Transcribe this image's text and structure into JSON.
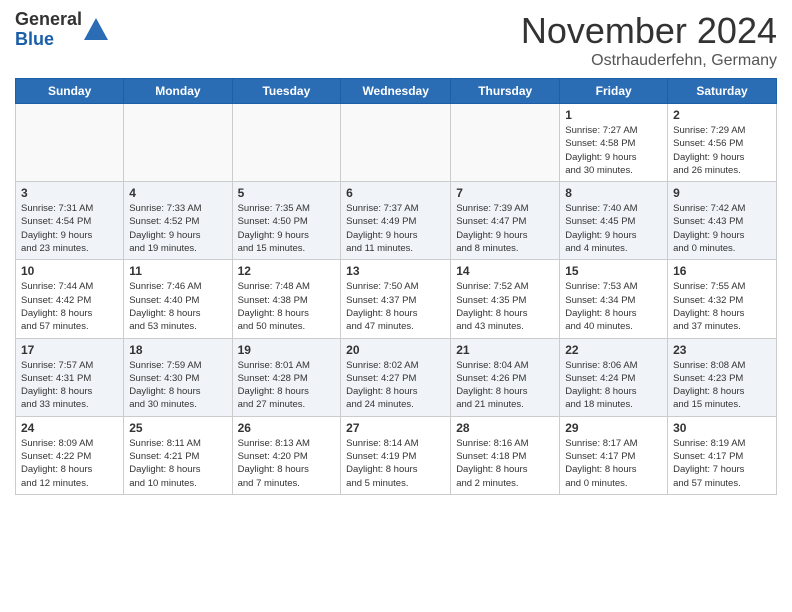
{
  "header": {
    "logo": {
      "general": "General",
      "blue": "Blue"
    },
    "title": "November 2024",
    "location": "Ostrhauderfehn, Germany"
  },
  "calendar": {
    "weekdays": [
      "Sunday",
      "Monday",
      "Tuesday",
      "Wednesday",
      "Thursday",
      "Friday",
      "Saturday"
    ],
    "rows": [
      [
        {
          "day": "",
          "info": ""
        },
        {
          "day": "",
          "info": ""
        },
        {
          "day": "",
          "info": ""
        },
        {
          "day": "",
          "info": ""
        },
        {
          "day": "",
          "info": ""
        },
        {
          "day": "1",
          "info": "Sunrise: 7:27 AM\nSunset: 4:58 PM\nDaylight: 9 hours\nand 30 minutes."
        },
        {
          "day": "2",
          "info": "Sunrise: 7:29 AM\nSunset: 4:56 PM\nDaylight: 9 hours\nand 26 minutes."
        }
      ],
      [
        {
          "day": "3",
          "info": "Sunrise: 7:31 AM\nSunset: 4:54 PM\nDaylight: 9 hours\nand 23 minutes."
        },
        {
          "day": "4",
          "info": "Sunrise: 7:33 AM\nSunset: 4:52 PM\nDaylight: 9 hours\nand 19 minutes."
        },
        {
          "day": "5",
          "info": "Sunrise: 7:35 AM\nSunset: 4:50 PM\nDaylight: 9 hours\nand 15 minutes."
        },
        {
          "day": "6",
          "info": "Sunrise: 7:37 AM\nSunset: 4:49 PM\nDaylight: 9 hours\nand 11 minutes."
        },
        {
          "day": "7",
          "info": "Sunrise: 7:39 AM\nSunset: 4:47 PM\nDaylight: 9 hours\nand 8 minutes."
        },
        {
          "day": "8",
          "info": "Sunrise: 7:40 AM\nSunset: 4:45 PM\nDaylight: 9 hours\nand 4 minutes."
        },
        {
          "day": "9",
          "info": "Sunrise: 7:42 AM\nSunset: 4:43 PM\nDaylight: 9 hours\nand 0 minutes."
        }
      ],
      [
        {
          "day": "10",
          "info": "Sunrise: 7:44 AM\nSunset: 4:42 PM\nDaylight: 8 hours\nand 57 minutes."
        },
        {
          "day": "11",
          "info": "Sunrise: 7:46 AM\nSunset: 4:40 PM\nDaylight: 8 hours\nand 53 minutes."
        },
        {
          "day": "12",
          "info": "Sunrise: 7:48 AM\nSunset: 4:38 PM\nDaylight: 8 hours\nand 50 minutes."
        },
        {
          "day": "13",
          "info": "Sunrise: 7:50 AM\nSunset: 4:37 PM\nDaylight: 8 hours\nand 47 minutes."
        },
        {
          "day": "14",
          "info": "Sunrise: 7:52 AM\nSunset: 4:35 PM\nDaylight: 8 hours\nand 43 minutes."
        },
        {
          "day": "15",
          "info": "Sunrise: 7:53 AM\nSunset: 4:34 PM\nDaylight: 8 hours\nand 40 minutes."
        },
        {
          "day": "16",
          "info": "Sunrise: 7:55 AM\nSunset: 4:32 PM\nDaylight: 8 hours\nand 37 minutes."
        }
      ],
      [
        {
          "day": "17",
          "info": "Sunrise: 7:57 AM\nSunset: 4:31 PM\nDaylight: 8 hours\nand 33 minutes."
        },
        {
          "day": "18",
          "info": "Sunrise: 7:59 AM\nSunset: 4:30 PM\nDaylight: 8 hours\nand 30 minutes."
        },
        {
          "day": "19",
          "info": "Sunrise: 8:01 AM\nSunset: 4:28 PM\nDaylight: 8 hours\nand 27 minutes."
        },
        {
          "day": "20",
          "info": "Sunrise: 8:02 AM\nSunset: 4:27 PM\nDaylight: 8 hours\nand 24 minutes."
        },
        {
          "day": "21",
          "info": "Sunrise: 8:04 AM\nSunset: 4:26 PM\nDaylight: 8 hours\nand 21 minutes."
        },
        {
          "day": "22",
          "info": "Sunrise: 8:06 AM\nSunset: 4:24 PM\nDaylight: 8 hours\nand 18 minutes."
        },
        {
          "day": "23",
          "info": "Sunrise: 8:08 AM\nSunset: 4:23 PM\nDaylight: 8 hours\nand 15 minutes."
        }
      ],
      [
        {
          "day": "24",
          "info": "Sunrise: 8:09 AM\nSunset: 4:22 PM\nDaylight: 8 hours\nand 12 minutes."
        },
        {
          "day": "25",
          "info": "Sunrise: 8:11 AM\nSunset: 4:21 PM\nDaylight: 8 hours\nand 10 minutes."
        },
        {
          "day": "26",
          "info": "Sunrise: 8:13 AM\nSunset: 4:20 PM\nDaylight: 8 hours\nand 7 minutes."
        },
        {
          "day": "27",
          "info": "Sunrise: 8:14 AM\nSunset: 4:19 PM\nDaylight: 8 hours\nand 5 minutes."
        },
        {
          "day": "28",
          "info": "Sunrise: 8:16 AM\nSunset: 4:18 PM\nDaylight: 8 hours\nand 2 minutes."
        },
        {
          "day": "29",
          "info": "Sunrise: 8:17 AM\nSunset: 4:17 PM\nDaylight: 8 hours\nand 0 minutes."
        },
        {
          "day": "30",
          "info": "Sunrise: 8:19 AM\nSunset: 4:17 PM\nDaylight: 7 hours\nand 57 minutes."
        }
      ]
    ]
  }
}
